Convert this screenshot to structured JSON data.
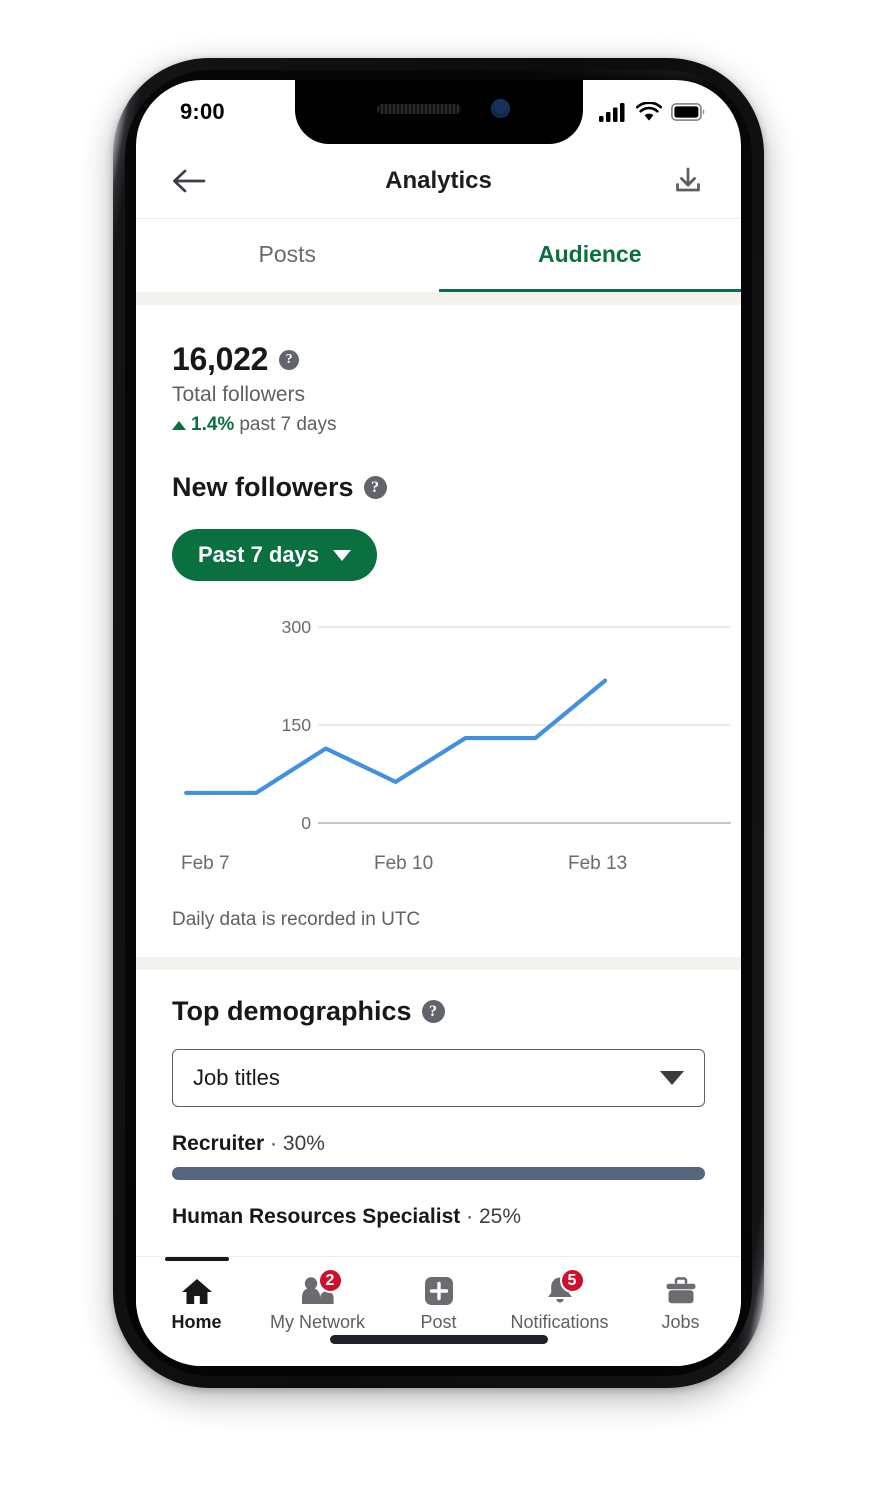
{
  "status_bar": {
    "time": "9:00",
    "icons": [
      "cellular-signal-icon",
      "wifi-icon",
      "battery-icon"
    ]
  },
  "header": {
    "back_icon": "back-arrow-icon",
    "title": "Analytics",
    "export_icon": "download-icon"
  },
  "tabs": [
    {
      "label": "Posts",
      "active": false
    },
    {
      "label": "Audience",
      "active": true
    }
  ],
  "followers": {
    "total": "16,022",
    "total_label": "Total followers",
    "help_icon": "help-circle-icon",
    "delta_value": "1.4%",
    "delta_period": "past 7 days",
    "delta_direction": "up",
    "section_title": "New followers",
    "range_button": "Past 7 days",
    "range_caret_icon": "chevron-down-icon",
    "note": "Daily data is recorded in UTC"
  },
  "chart_data": {
    "type": "line",
    "title": "New followers",
    "x": [
      "Feb 7",
      "Feb 8",
      "Feb 9",
      "Feb 10",
      "Feb 11",
      "Feb 12",
      "Feb 13"
    ],
    "tick_labels": [
      "Feb 7",
      "Feb 10",
      "Feb 13"
    ],
    "tick_indices": [
      0,
      3,
      6
    ],
    "values": [
      46,
      46,
      114,
      63,
      130,
      130,
      218
    ],
    "ylabel": "",
    "xlabel": "",
    "ylim": [
      0,
      300
    ],
    "yticks": [
      0,
      150,
      300
    ],
    "ytick_labels": [
      "0",
      "150",
      "300"
    ],
    "grid": true,
    "legend": "none",
    "line_color": "#4290e0",
    "annotation": "Daily data is recorded in UTC"
  },
  "demographics": {
    "title": "Top demographics",
    "help_icon": "help-circle-icon",
    "select_value": "Job titles",
    "select_caret_icon": "chevron-down-icon",
    "items": [
      {
        "name": "Recruiter",
        "separator": "·",
        "percent": "30%",
        "fill": 100
      },
      {
        "name": "Human Resources Specialist",
        "separator": "·",
        "percent": "25%",
        "fill": 83
      }
    ]
  },
  "bottom_nav": [
    {
      "label": "Home",
      "icon": "home-icon",
      "active": true,
      "badge": ""
    },
    {
      "label": "My Network",
      "icon": "people-icon",
      "active": false,
      "badge": "2"
    },
    {
      "label": "Post",
      "icon": "plus-square-icon",
      "active": false,
      "badge": ""
    },
    {
      "label": "Notifications",
      "icon": "bell-icon",
      "active": false,
      "badge": "5"
    },
    {
      "label": "Jobs",
      "icon": "briefcase-icon",
      "active": false,
      "badge": ""
    }
  ],
  "colors": {
    "brand_green": "#0a7040",
    "chart_line": "#4290e0",
    "bar_slate": "#54667e",
    "badge_red": "#cb112d",
    "band_gray": "#f3f2ef"
  }
}
